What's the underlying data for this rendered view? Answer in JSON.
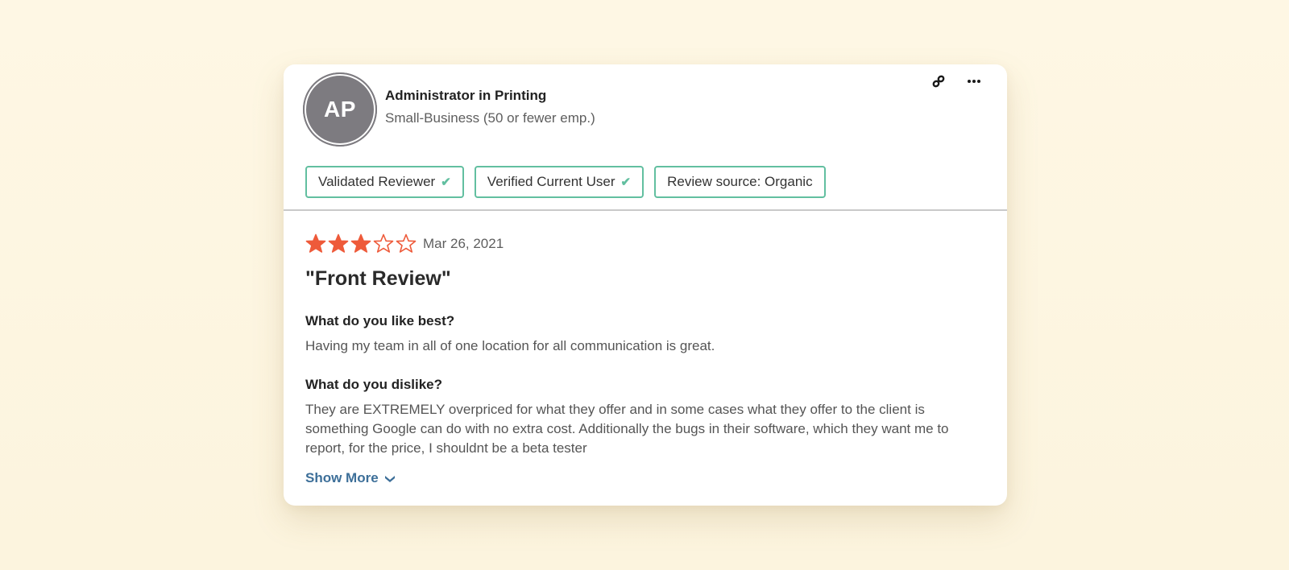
{
  "reviewer": {
    "initials": "AP",
    "title": "Administrator in Printing",
    "company_size": "Small-Business (50 or fewer emp.)"
  },
  "actions": [
    {
      "name": "link-icon",
      "label": "Copy link"
    },
    {
      "name": "more-options-icon",
      "label": "More options"
    }
  ],
  "badges": [
    {
      "label": "Validated Reviewer",
      "checked": true
    },
    {
      "label": "Verified Current User",
      "checked": true
    },
    {
      "label": "Review source: Organic",
      "checked": false
    }
  ],
  "review": {
    "rating": 3,
    "rating_max": 5,
    "date": "Mar 26, 2021",
    "title": "\"Front Review\"",
    "sections": [
      {
        "question": "What do you like best?",
        "answer": "Having my team in all of one location for all communication is great."
      },
      {
        "question": "What do you dislike?",
        "answer": "They are EXTREMELY overpriced for what they offer and in some cases what they offer to the client is something Google can do with no extra cost. Additionally the bugs in their software, which they want me to report, for the price, I shouldnt be a beta tester"
      }
    ],
    "show_more_label": "Show More"
  },
  "colors": {
    "star": "#ee5a3a",
    "badge_border": "#62bfa0",
    "link": "#3d6f99",
    "avatar_bg": "#7d7b80",
    "page_bg": "#fdf6e3"
  }
}
